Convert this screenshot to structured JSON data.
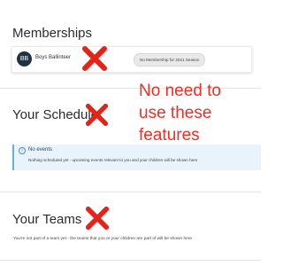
{
  "memberships": {
    "heading": "Memberships",
    "member": {
      "initials": "BB",
      "name": "Boys Ballinteer"
    },
    "badge": "No Membership for 2021 Season"
  },
  "schedule": {
    "heading": "Your Schedule",
    "info_title": "No events",
    "info_text": "Nothing scheduled yet - upcoming events relevant to you and your children will be shown here"
  },
  "teams": {
    "heading": "Your Teams",
    "text": "You're not part of a team yet - the teams that you or your children are part of will be shown here"
  },
  "annotation": {
    "line1": "No need to",
    "line2": "use these",
    "line3": "features",
    "color": "#ef2e24"
  },
  "icons": {
    "cross_mark": "x-mark-icon",
    "info": "info-icon"
  }
}
